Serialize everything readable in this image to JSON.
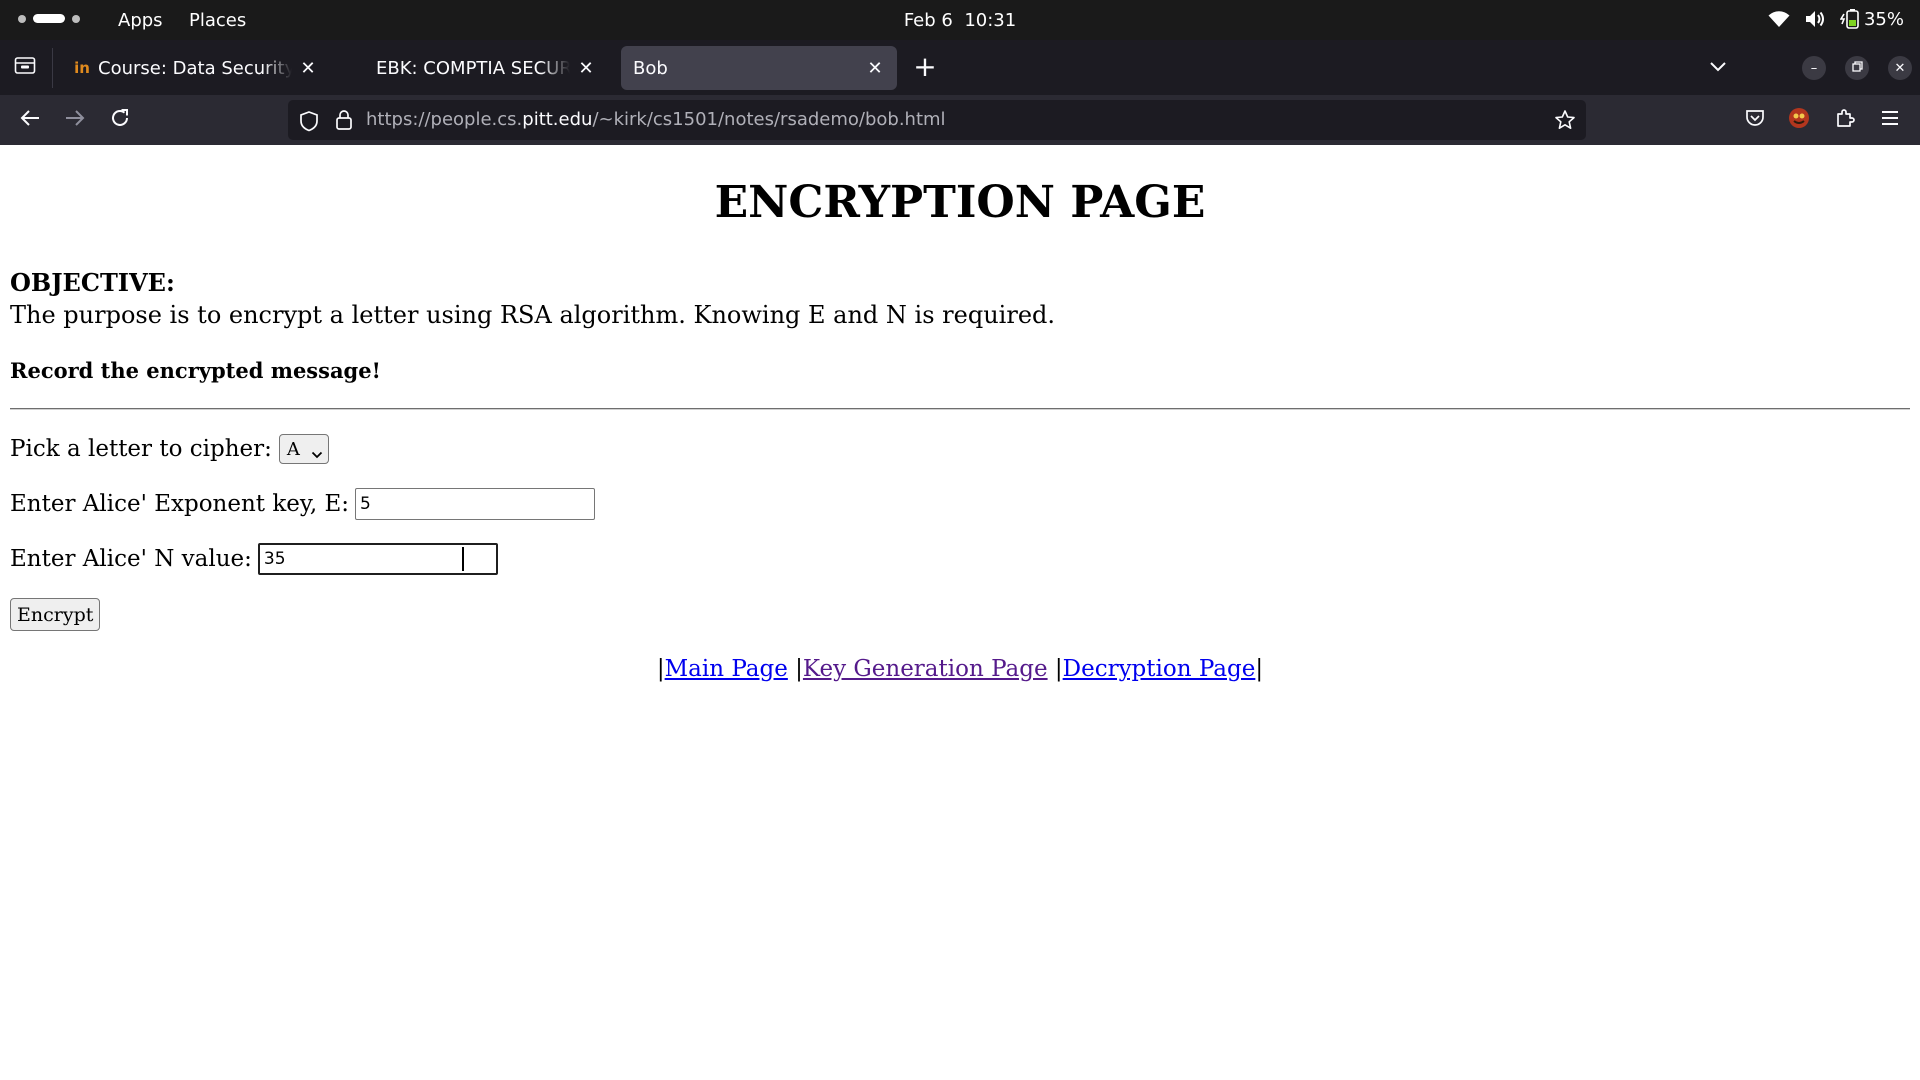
{
  "system_bar": {
    "apps_label": "Apps",
    "places_label": "Places",
    "date": "Feb 6",
    "time": "10:31",
    "battery_percent": "35%"
  },
  "browser": {
    "tabs": [
      {
        "title": "Course: Data Security and",
        "favicon": "in",
        "active": false
      },
      {
        "title": "EBK: COMPTIA SECURITY+",
        "active": false
      },
      {
        "title": "Bob",
        "active": true
      }
    ],
    "url": {
      "scheme": "https://",
      "sub": "people.cs.",
      "host": "pitt.edu",
      "path": "/~kirk/cs1501/notes/rsademo/bob.html"
    },
    "colors": {
      "toolbar": "#2b2a33",
      "tabstrip": "#1c1b22",
      "active_tab": "#42414d"
    }
  },
  "page": {
    "title": "ENCRYPTION PAGE",
    "objective_heading": "OBJECTIVE:",
    "objective_text": "The purpose is to encrypt a letter using RSA algorithm. Knowing E and N is required.",
    "record_text": "Record the encrypted message!",
    "letter_label": "Pick a letter to cipher:",
    "letter_selected": "A",
    "exponent_label": "Enter Alice' Exponent key, E:",
    "exponent_value": "5",
    "n_label": "Enter Alice' N value:",
    "n_value": "35",
    "encrypt_button": "Encrypt",
    "links": {
      "main": "Main Page",
      "keygen": "Key Generation Page",
      "decrypt": "Decryption Page",
      "separator": "|"
    }
  }
}
